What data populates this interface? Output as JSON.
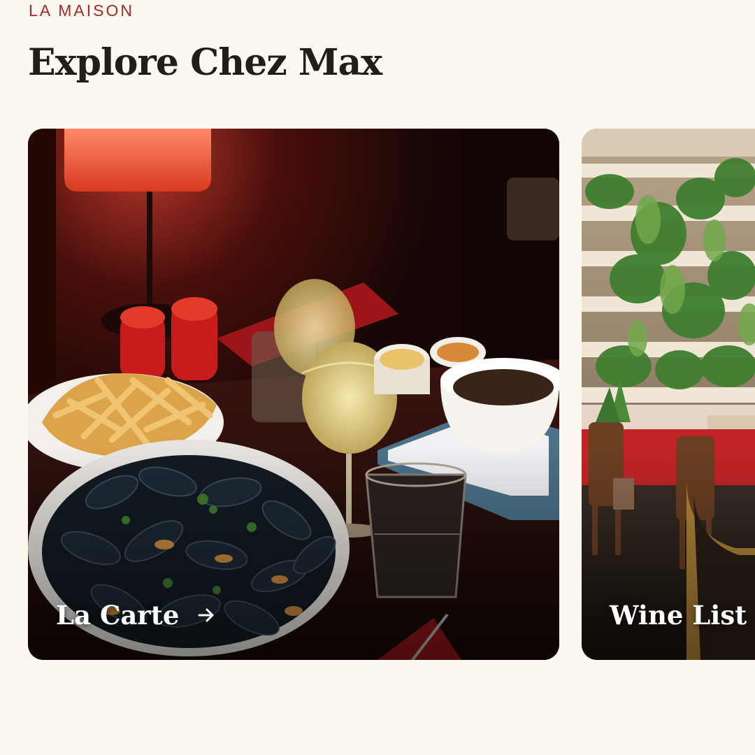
{
  "section": {
    "eyebrow": "LA MAISON",
    "title": "Explore Chez Max"
  },
  "cards": [
    {
      "label": "La Carte",
      "icon": "arrow-right-icon"
    },
    {
      "label": "Wine List",
      "icon": "arrow-right-icon"
    }
  ],
  "colors": {
    "background": "#fcf8f0",
    "accent": "#a52a2a",
    "title": "#221d18"
  }
}
